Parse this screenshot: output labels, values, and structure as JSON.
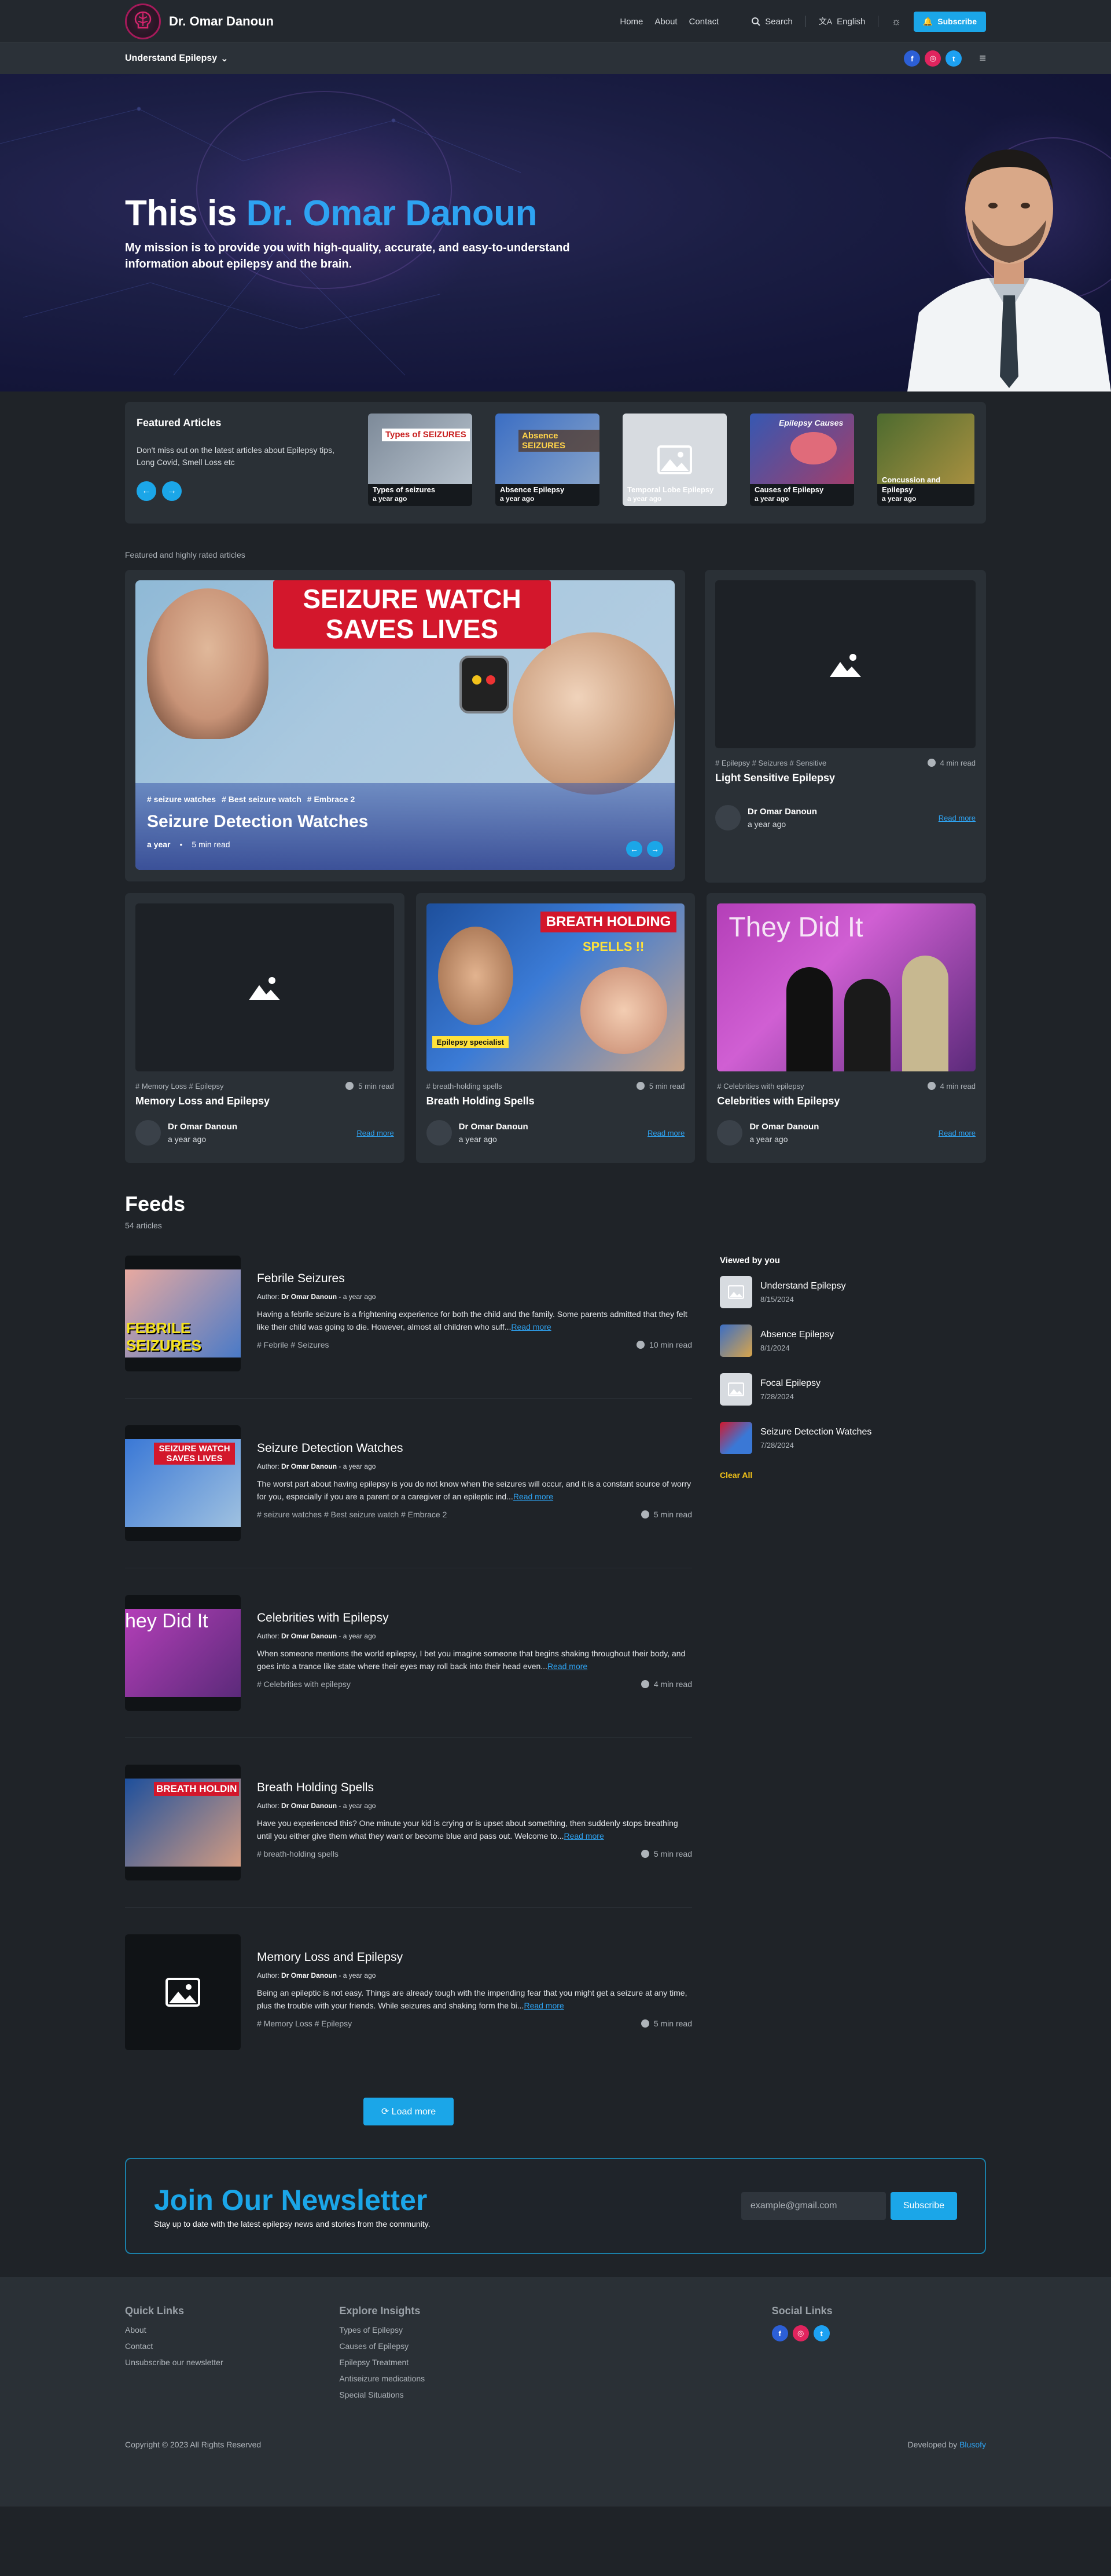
{
  "brand": {
    "name": "Dr. Omar Danoun"
  },
  "nav": {
    "links": [
      "Home",
      "About",
      "Contact"
    ],
    "search": "Search",
    "language": "English",
    "subscribe": "Subscribe",
    "menu": "Understand Epilepsy"
  },
  "hero": {
    "title_prefix": "This is ",
    "title_name": "Dr. Omar Danoun",
    "subtitle": "My mission is to provide you with high-quality, accurate, and easy-to-understand information about epilepsy and the brain."
  },
  "featured": {
    "title": "Featured Articles",
    "desc": "Don't miss out on the latest articles about Epilepsy tips, Long Covid, Smell Loss etc",
    "cards": [
      {
        "label": "Types of seizures",
        "time": "a year ago",
        "thumb_text": "Types of SEIZURES"
      },
      {
        "label": "Absence Epilepsy",
        "time": "a year ago",
        "thumb_text": "Absence SEIZURES"
      },
      {
        "label": "Temporal Lobe Epilepsy",
        "time": "a year ago",
        "thumb_text": ""
      },
      {
        "label": "Causes of Epilepsy",
        "time": "a year ago",
        "thumb_text": "Epilepsy Causes"
      },
      {
        "label": "Concussion and Epilepsy",
        "time": "a year ago",
        "thumb_text": ""
      }
    ]
  },
  "highlighted_label": "Featured and highly rated articles",
  "big_post": {
    "banner": "SEIZURE WATCH SAVES LIVES",
    "tags": [
      "# seizure watches",
      "# Best seizure watch",
      "# Embrace 2"
    ],
    "title": "Seizure Detection Watches",
    "time": "a year",
    "read": "5 min read"
  },
  "side_post": {
    "tags": "# Epilepsy  # Seizures  # Sensitive",
    "read": "4 min read",
    "title": "Light Sensitive Epilepsy",
    "author": "Dr Omar Danoun",
    "ago": "a year ago",
    "readmore": "Read more"
  },
  "cards": [
    {
      "tags": "# Memory Loss  # Epilepsy",
      "read": "5 min read",
      "title": "Memory Loss and Epilepsy",
      "author": "Dr Omar Danoun",
      "ago": "a year ago",
      "readmore": "Read more"
    },
    {
      "tags": "# breath-holding spells",
      "read": "5 min read",
      "title": "Breath Holding Spells",
      "author": "Dr Omar Danoun",
      "ago": "a year ago",
      "readmore": "Read more",
      "banner": "BREATH HOLDING",
      "banner2": "SPELLS !!",
      "badge": "Epilepsy specialist"
    },
    {
      "tags": "# Celebrities with epilepsy",
      "read": "4 min read",
      "title": "Celebrities with Epilepsy",
      "author": "Dr Omar Danoun",
      "ago": "a year ago",
      "readmore": "Read more",
      "banner": "They Did It"
    }
  ],
  "feeds": {
    "title": "Feeds",
    "count": "54 articles",
    "items": [
      {
        "title": "Febrile Seizures",
        "author_label": "Author:",
        "author": "Dr Omar Danoun",
        "ago": "- a year ago",
        "excerpt": "Having a febrile seizure is a frightening experience for both the child and the family. Some parents admitted that they felt like their child was going to die. However, almost all children who suff...",
        "readmore": "Read more",
        "tags": "# Febrile  # Seizures",
        "read": "10 min read",
        "thumb_text": "FEBRILE SEIZURES"
      },
      {
        "title": "Seizure Detection Watches",
        "author_label": "Author:",
        "author": "Dr Omar Danoun",
        "ago": "- a year ago",
        "excerpt": "The worst part about having epilepsy is you do not know when the seizures will occur, and it is a constant source of worry for you, especially if you are a parent or a caregiver of an epileptic ind...",
        "readmore": "Read more",
        "tags": "# seizure watches  # Best seizure watch  # Embrace 2",
        "read": "5 min read",
        "thumb_text": "SEIZURE WATCH SAVES LIVES"
      },
      {
        "title": "Celebrities with Epilepsy",
        "author_label": "Author:",
        "author": "Dr Omar Danoun",
        "ago": "- a year ago",
        "excerpt": "When someone mentions the world epilepsy, I bet you imagine someone that begins shaking throughout their body, and goes into a trance like state where their eyes may roll back into their head even...",
        "readmore": "Read more",
        "tags": "# Celebrities with epilepsy",
        "read": "4 min read",
        "thumb_text": "hey Did It"
      },
      {
        "title": "Breath Holding Spells",
        "author_label": "Author:",
        "author": "Dr Omar Danoun",
        "ago": "- a year ago",
        "excerpt": "Have you experienced this? One minute your kid is crying or is upset about something, then suddenly stops breathing until you either give them what they want or become blue and pass out. Welcome to...",
        "readmore": "Read more",
        "tags": "# breath-holding spells",
        "read": "5 min read",
        "thumb_text": "BREATH HOLDIN"
      },
      {
        "title": "Memory Loss and Epilepsy",
        "author_label": "Author:",
        "author": "Dr Omar Danoun",
        "ago": "- a year ago",
        "excerpt": "Being an epileptic is not easy. Things are already tough with the impending fear that you might get a seizure at any time, plus the trouble with your friends. While seizures and shaking form the bi...",
        "readmore": "Read more",
        "tags": "# Memory Loss  # Epilepsy",
        "read": "5 min read",
        "thumb_text": ""
      }
    ],
    "load_more": "Load more"
  },
  "viewed": {
    "title": "Viewed by you",
    "items": [
      {
        "title": "Understand Epilepsy",
        "date": "8/15/2024"
      },
      {
        "title": "Absence Epilepsy",
        "date": "8/1/2024"
      },
      {
        "title": "Focal Epilepsy",
        "date": "7/28/2024"
      },
      {
        "title": "Seizure Detection Watches",
        "date": "7/28/2024"
      }
    ],
    "clear": "Clear All"
  },
  "newsletter": {
    "title": "Join Our Newsletter",
    "subtitle": "Stay up to date with the latest epilepsy news and stories from the community.",
    "placeholder": "example@gmail.com",
    "button": "Subscribe"
  },
  "footer": {
    "quick_title": "Quick Links",
    "quick": [
      "About",
      "Contact",
      "Unsubscribe our newsletter"
    ],
    "explore_title": "Explore Insights",
    "explore": [
      "Types of Epilepsy",
      "Causes of Epilepsy",
      "Epilepsy Treatment",
      "Antiseizure medications",
      "Special Situations"
    ],
    "social_title": "Social Links",
    "copyright": "Copyright © 2023 All Rights Reserved",
    "developed": "Developed by",
    "developer": "Blusofy"
  },
  "colors": {
    "accent": "#1ba6e8",
    "background": "#1f2328",
    "card": "#2a3036",
    "clear": "#f5c518"
  }
}
